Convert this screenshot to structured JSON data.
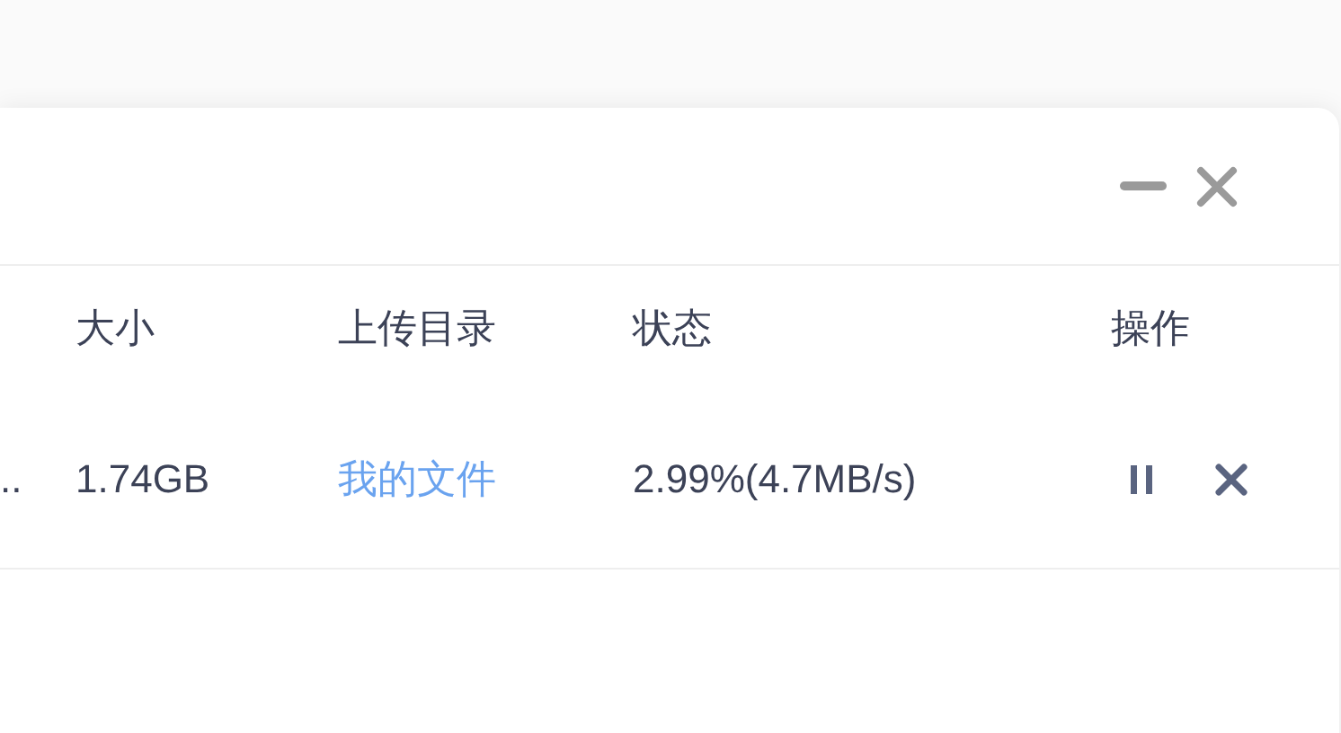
{
  "table": {
    "columns": [
      "大小",
      "上传目录",
      "状态",
      "操作"
    ],
    "rows": [
      {
        "name": "..",
        "size": "1.74GB",
        "directory": "我的文件",
        "status": "2.99%(4.7MB/s)",
        "paused": false
      }
    ]
  }
}
